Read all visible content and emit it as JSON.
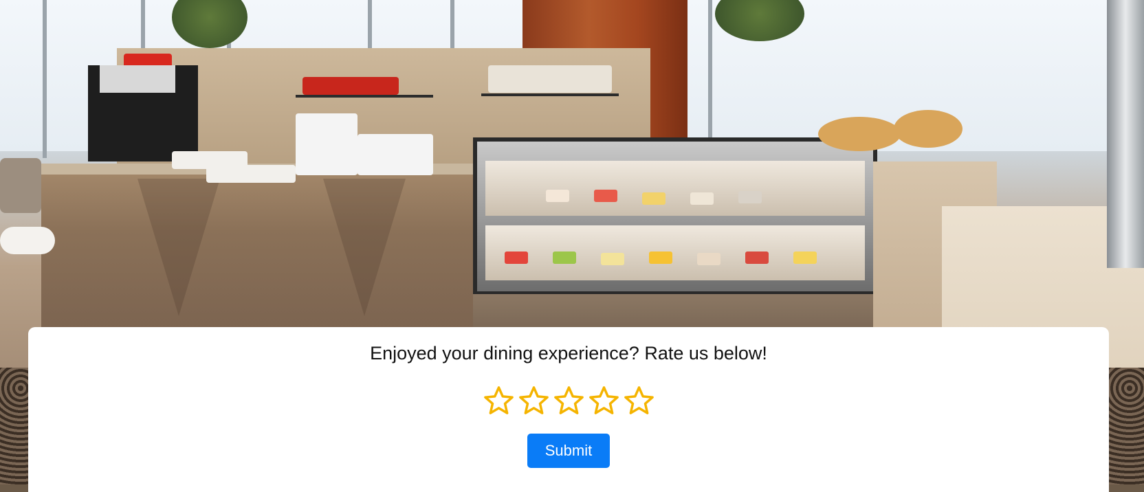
{
  "rating": {
    "prompt": "Enjoyed your dining experience? Rate us below!",
    "stars": [
      {
        "icon": "star-outline-icon",
        "filled": false
      },
      {
        "icon": "star-outline-icon",
        "filled": false
      },
      {
        "icon": "star-outline-icon",
        "filled": false
      },
      {
        "icon": "star-outline-icon",
        "filled": false
      },
      {
        "icon": "star-outline-icon",
        "filled": false
      }
    ],
    "max_stars": 5,
    "selected_stars": 0,
    "star_color": "#f5b400",
    "submit_label": "Submit",
    "submit_color": "#0a7cf7"
  }
}
